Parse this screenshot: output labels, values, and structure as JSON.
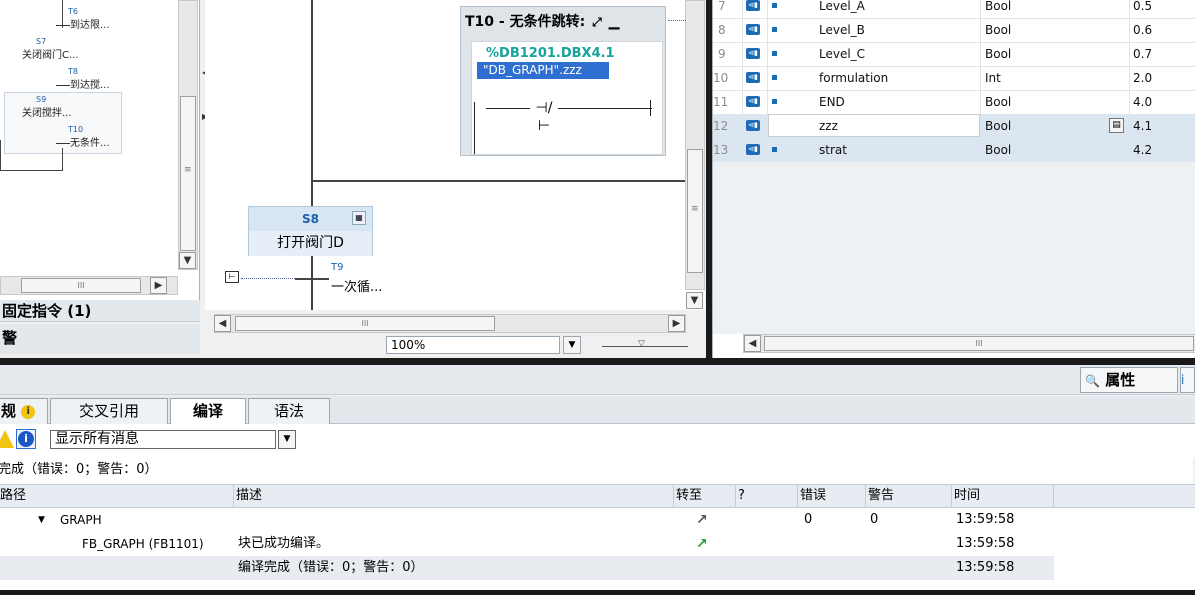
{
  "left_pane": {
    "steps": [
      {
        "num": "T6",
        "label": "到达限..."
      },
      {
        "num": "S7",
        "label": "关闭阀门C..."
      },
      {
        "num": "T8",
        "label": "到达搅..."
      },
      {
        "num": "S9",
        "label": "关闭搅拌..."
      },
      {
        "num": "T10",
        "label": "无条件..."
      }
    ],
    "scroll_glyph": "III",
    "fixed_instructions": "固定指令 (1)",
    "alarm": "警"
  },
  "editor": {
    "transition_title": "T10 - 无条件跳转:",
    "address": "%DB1201.DBX4.1",
    "tag": "\"DB_GRAPH\".zzz",
    "step_num": "S8",
    "step_name": "打开阀门D",
    "trans_num": "T9",
    "trans_label": "一次循...",
    "zoom": "100%",
    "scroll_glyph": "III"
  },
  "table": {
    "rows": [
      {
        "num": "7",
        "name": "Level_A",
        "type": "Bool",
        "offset": "0.5"
      },
      {
        "num": "8",
        "name": "Level_B",
        "type": "Bool",
        "offset": "0.6"
      },
      {
        "num": "9",
        "name": "Level_C",
        "type": "Bool",
        "offset": "0.7"
      },
      {
        "num": "10",
        "name": "formulation",
        "type": "Int",
        "offset": "2.0"
      },
      {
        "num": "11",
        "name": "END",
        "type": "Bool",
        "offset": "4.0"
      },
      {
        "num": "12",
        "name": "zzz",
        "type": "Bool",
        "offset": "4.1"
      },
      {
        "num": "13",
        "name": "strat",
        "type": "Bool",
        "offset": "4.2"
      }
    ],
    "scroll_glyph": "III"
  },
  "inspector": {
    "properties": "属性"
  },
  "tabs": {
    "t0": "规",
    "cross_ref": "交叉引用",
    "compile": "编译",
    "syntax": "语法"
  },
  "filter": {
    "selected": "显示所有消息"
  },
  "summary": "完成（错误：0；警告：0）",
  "messages": {
    "headers": {
      "path": "路径",
      "description": "描述",
      "goto": "转至",
      "q": "?",
      "errors": "错误",
      "warnings": "警告",
      "time": "时间"
    },
    "rows": [
      {
        "path": "GRAPH",
        "description": "",
        "errors": "0",
        "warnings": "0",
        "time": "13:59:58"
      },
      {
        "path": "FB_GRAPH (FB1101)",
        "description": "块已成功编译。",
        "errors": "",
        "warnings": "",
        "time": "13:59:58"
      },
      {
        "path": "",
        "description": "编译完成（错误：0；警告：0）",
        "errors": "",
        "warnings": "",
        "time": "13:59:58"
      }
    ]
  },
  "colors": {
    "accent": "#1d6bb5",
    "goto_arrow_active": "#1e9e3c",
    "goto_arrow_inactive": "#555555",
    "selection": "#2f6fd1",
    "address": "#17a39b"
  }
}
